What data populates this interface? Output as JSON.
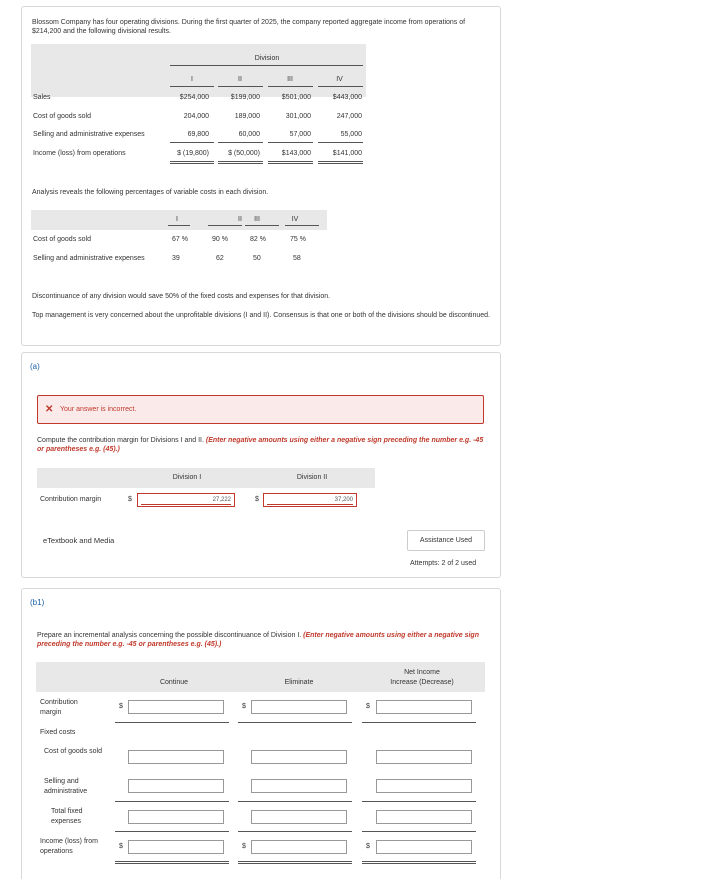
{
  "intro": {
    "para1": "Blossom Company has four operating divisions. During the first quarter of 2025, the company reported aggregate income from operations of $214,200 and the following divisional results.",
    "table1": {
      "division_header": "Division",
      "columns": [
        "I",
        "II",
        "III",
        "IV"
      ],
      "rows": [
        {
          "label": "Sales",
          "values": [
            "$254,000",
            "$199,000",
            "$501,000",
            "$443,000"
          ]
        },
        {
          "label": "Cost of goods sold",
          "values": [
            "204,000",
            "189,000",
            "301,000",
            "247,000"
          ]
        },
        {
          "label": "Selling and administrative expenses",
          "values": [
            "69,800",
            "60,000",
            "57,000",
            "55,000"
          ]
        },
        {
          "label": "Income (loss) from operations",
          "values": [
            "$ (19,800)",
            "$ (50,000)",
            "$143,000",
            "$141,000"
          ]
        }
      ]
    },
    "para2": "Analysis reveals the following percentages of variable costs in each division.",
    "table2": {
      "columns": [
        "I",
        "II",
        "III",
        "IV"
      ],
      "rows": [
        {
          "label": "Cost of goods sold",
          "values": [
            "67  %",
            "90  %",
            "82  %",
            "75  %"
          ]
        },
        {
          "label": "Selling and administrative expenses",
          "values": [
            "39",
            "62",
            "50",
            "58"
          ]
        }
      ]
    },
    "para3": "Discontinuance of any division would save 50% of the fixed costs and expenses for that division.",
    "para4": "Top management is very concerned about the unprofitable divisions (I and II). Consensus is that one or both of the divisions should be discontinued."
  },
  "partA": {
    "label": "(a)",
    "error": "Your answer is incorrect.",
    "instruction_plain": "Compute the contribution margin for Divisions I and II.",
    "instruction_red": "(Enter negative amounts using either a negative sign preceding the number e.g. -45 or parentheses e.g. (45).)",
    "col1": "Division I",
    "col2": "Division II",
    "row_label": "Contribution margin",
    "currency": "$",
    "values": [
      "27,222",
      "37,200"
    ],
    "ebook": "eTextbook and Media",
    "assist": "Assistance Used",
    "attempts": "Attempts: 2 of 2 used"
  },
  "partB": {
    "label": "(b1)",
    "instruction_plain": "Prepare an incremental analysis concerning the possible discontinuance of Division I.",
    "instruction_red": "(Enter negative amounts using either a negative sign preceding the number e.g. -45 or parentheses e.g. (45).)",
    "col1": "Continue",
    "col2": "Eliminate",
    "col3_line1": "Net Income",
    "col3_line2": "Increase (Decrease)",
    "currency": "$",
    "rows": {
      "cm": "Contribution margin",
      "fixed": "Fixed costs",
      "cogs": "Cost of goods sold",
      "sa": "Selling and administrative",
      "total_fixed": "Total fixed expenses",
      "income": "Income (loss) from operations"
    }
  }
}
